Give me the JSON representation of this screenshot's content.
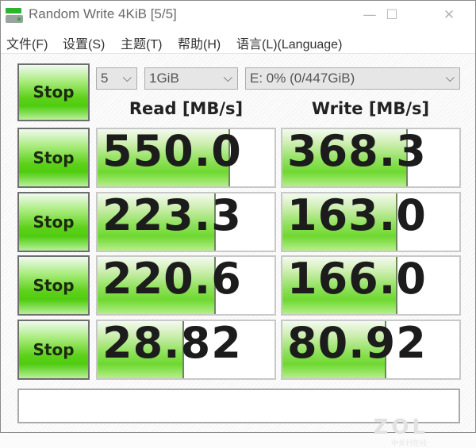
{
  "window": {
    "title": "Random Write 4KiB [5/5]",
    "icon": "drive-icon",
    "controls": {
      "minimize": "—",
      "maximize": "☐",
      "close": "✕"
    }
  },
  "menu": [
    {
      "label": "文件(F)"
    },
    {
      "label": "设置(S)"
    },
    {
      "label": "主题(T)"
    },
    {
      "label": "帮助(H)"
    },
    {
      "label": "语言(L)(Language)"
    }
  ],
  "controls": {
    "all_button": "Stop",
    "count_select": "5",
    "size_select": "1GiB",
    "drive_select": "E: 0% (0/447GiB)"
  },
  "headers": {
    "read": "Read [MB/s]",
    "write": "Write [MB/s]"
  },
  "rows": [
    {
      "button": "Stop",
      "read": "550.0",
      "read_fill": 0.74,
      "write": "368.3",
      "write_fill": 0.7
    },
    {
      "button": "Stop",
      "read": "223.3",
      "read_fill": 0.66,
      "write": "163.0",
      "write_fill": 0.64
    },
    {
      "button": "Stop",
      "read": "220.6",
      "read_fill": 0.66,
      "write": "166.0",
      "write_fill": 0.64
    },
    {
      "button": "Stop",
      "read": "28.82",
      "read_fill": 0.48,
      "write": "80.92",
      "write_fill": 0.58
    }
  ],
  "status": {
    "text": "",
    "watermark": "ZOL",
    "watermark_sub": "中关村在线"
  },
  "colors": {
    "accent_green": "#5ed11a",
    "text_dark": "#1c1c1c"
  }
}
